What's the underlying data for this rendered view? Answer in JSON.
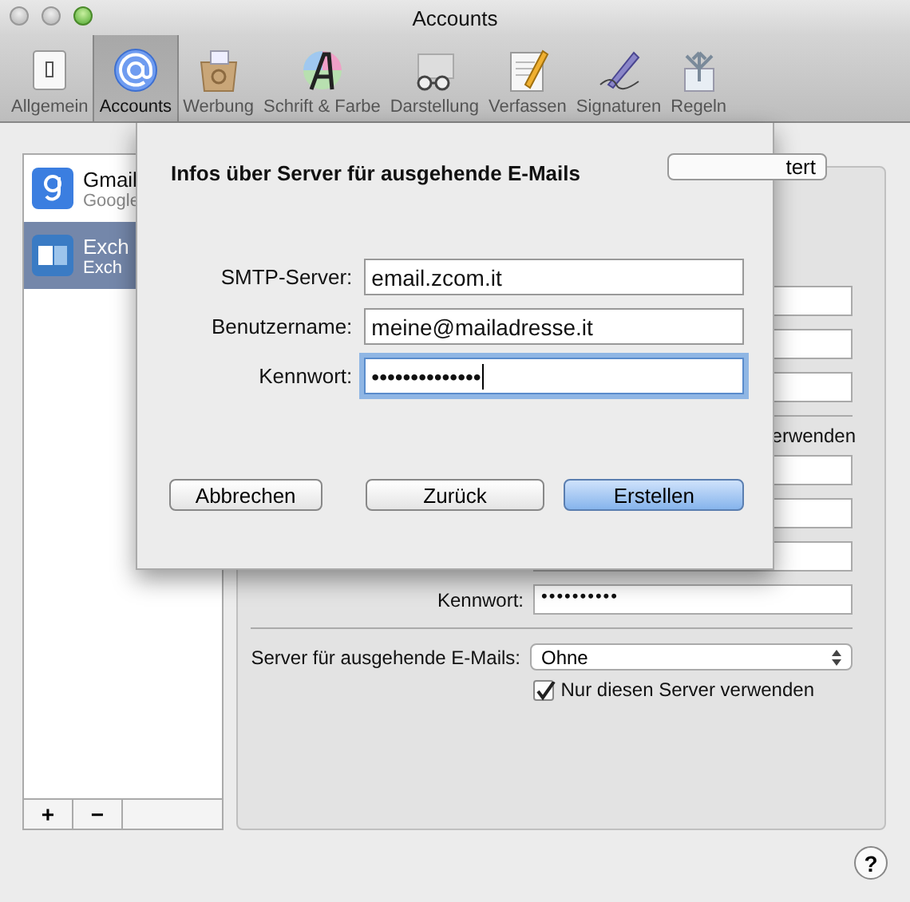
{
  "window": {
    "title": "Accounts"
  },
  "toolbar": [
    {
      "label": "Allgemein",
      "selected": false
    },
    {
      "label": "Accounts",
      "selected": true
    },
    {
      "label": "Werbung",
      "selected": false
    },
    {
      "label": "Schrift & Farbe",
      "selected": false
    },
    {
      "label": "Darstellung",
      "selected": false
    },
    {
      "label": "Verfassen",
      "selected": false
    },
    {
      "label": "Signaturen",
      "selected": false
    },
    {
      "label": "Regeln",
      "selected": false
    }
  ],
  "accounts": [
    {
      "name": "Gmail",
      "type": "Google",
      "selected": false
    },
    {
      "name": "Exch",
      "type": "Exch",
      "selected": true
    }
  ],
  "list_buttons": [
    "+",
    "−"
  ],
  "account_panel": {
    "tab_fragment": "tert",
    "auto_detect_fragment": "erwenden",
    "password": {
      "label": "Kennwort:",
      "value": "••••••••••"
    },
    "outgoing_server": {
      "label": "Server für ausgehende E-Mails:",
      "value": "Ohne"
    },
    "only_this_server": {
      "label": "Nur diesen Server verwenden",
      "checked": true
    }
  },
  "help": "?",
  "sheet": {
    "title": "Infos über Server für ausgehende E-Mails",
    "fields": [
      {
        "label": "SMTP-Server:",
        "value": "email.zcom.it",
        "focused": false
      },
      {
        "label": "Benutzername:",
        "value": "meine@mailadresse.it",
        "focused": false
      },
      {
        "label": "Kennwort:",
        "value": "••••••••••••••",
        "focused": true
      }
    ],
    "buttons": [
      {
        "label": "Abbrechen",
        "default": false
      },
      {
        "label": "Zurück",
        "default": false
      },
      {
        "label": "Erstellen",
        "default": true
      }
    ]
  }
}
